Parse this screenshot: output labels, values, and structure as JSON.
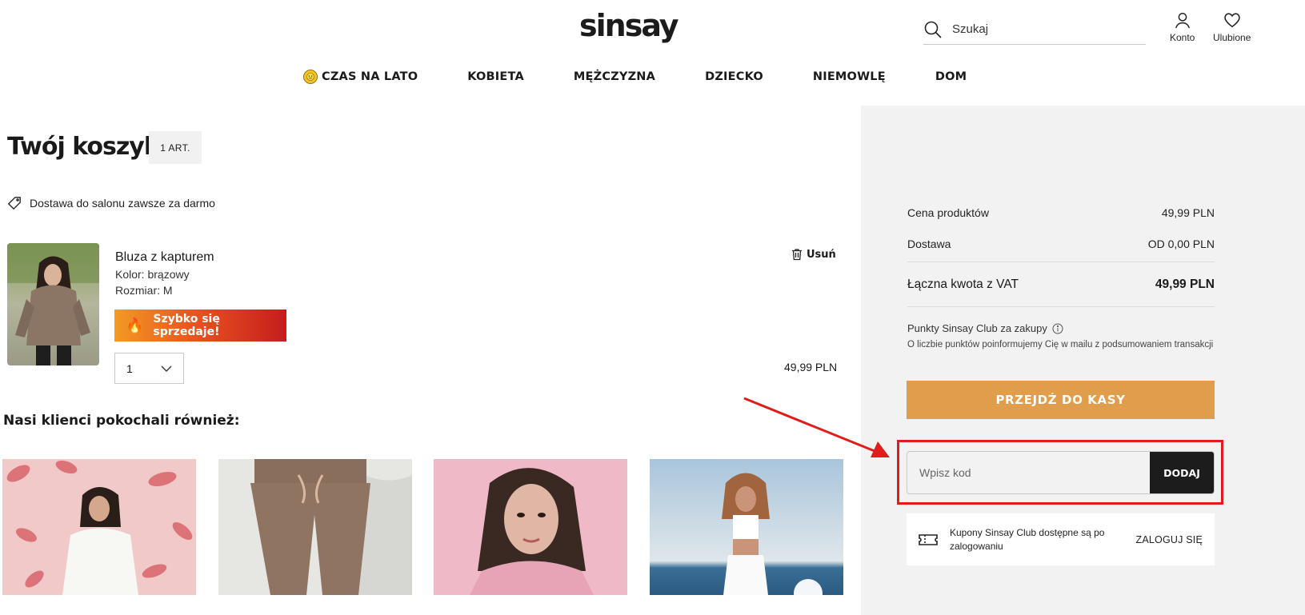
{
  "header": {
    "logo": "sinsay",
    "search_placeholder": "Szukaj",
    "account_label": "Konto",
    "favorites_label": "Ulubione"
  },
  "nav": {
    "items": [
      {
        "label": "CZAS NA LATO",
        "icon": "sun-icon"
      },
      {
        "label": "KOBIETA"
      },
      {
        "label": "MĘŻCZYZNA"
      },
      {
        "label": "DZIECKO"
      },
      {
        "label": "NIEMOWLĘ"
      },
      {
        "label": "DOM"
      }
    ]
  },
  "cart": {
    "title": "Twój koszyk",
    "count": "1 ART.",
    "delivery_note": "Dostawa do salonu zawsze za darmo",
    "item": {
      "name": "Bluza z kapturem",
      "color": "Kolor: brązowy",
      "size": "Rozmiar: M",
      "badge": "Szybko się sprzedaje!",
      "quantity": "1",
      "remove_label": "Usuń",
      "price": "49,99 PLN"
    }
  },
  "recommendations": {
    "title": "Nasi klienci pokochali również:"
  },
  "summary": {
    "products_label": "Cena produktów",
    "products_value": "49,99 PLN",
    "delivery_label": "Dostawa",
    "delivery_value": "OD 0,00 PLN",
    "total_label": "Łączna kwota z VAT",
    "total_value": "49,99 PLN",
    "points_title": "Punkty Sinsay Club za zakupy",
    "points_note": "O liczbie punktów poinformujemy Cię w mailu z podsumowaniem transakcji",
    "checkout_label": "PRZEJDŹ DO KASY",
    "code_placeholder": "Wpisz kod",
    "code_button": "DODAJ",
    "coupon_text": "Kupony Sinsay Club dostępne są po zalogowaniu",
    "coupon_login": "ZALOGUJ SIĘ"
  },
  "colors": {
    "checkout": "#e09d4c",
    "highlight": "#e01c1c",
    "summary_bg": "#f2f2f2"
  }
}
